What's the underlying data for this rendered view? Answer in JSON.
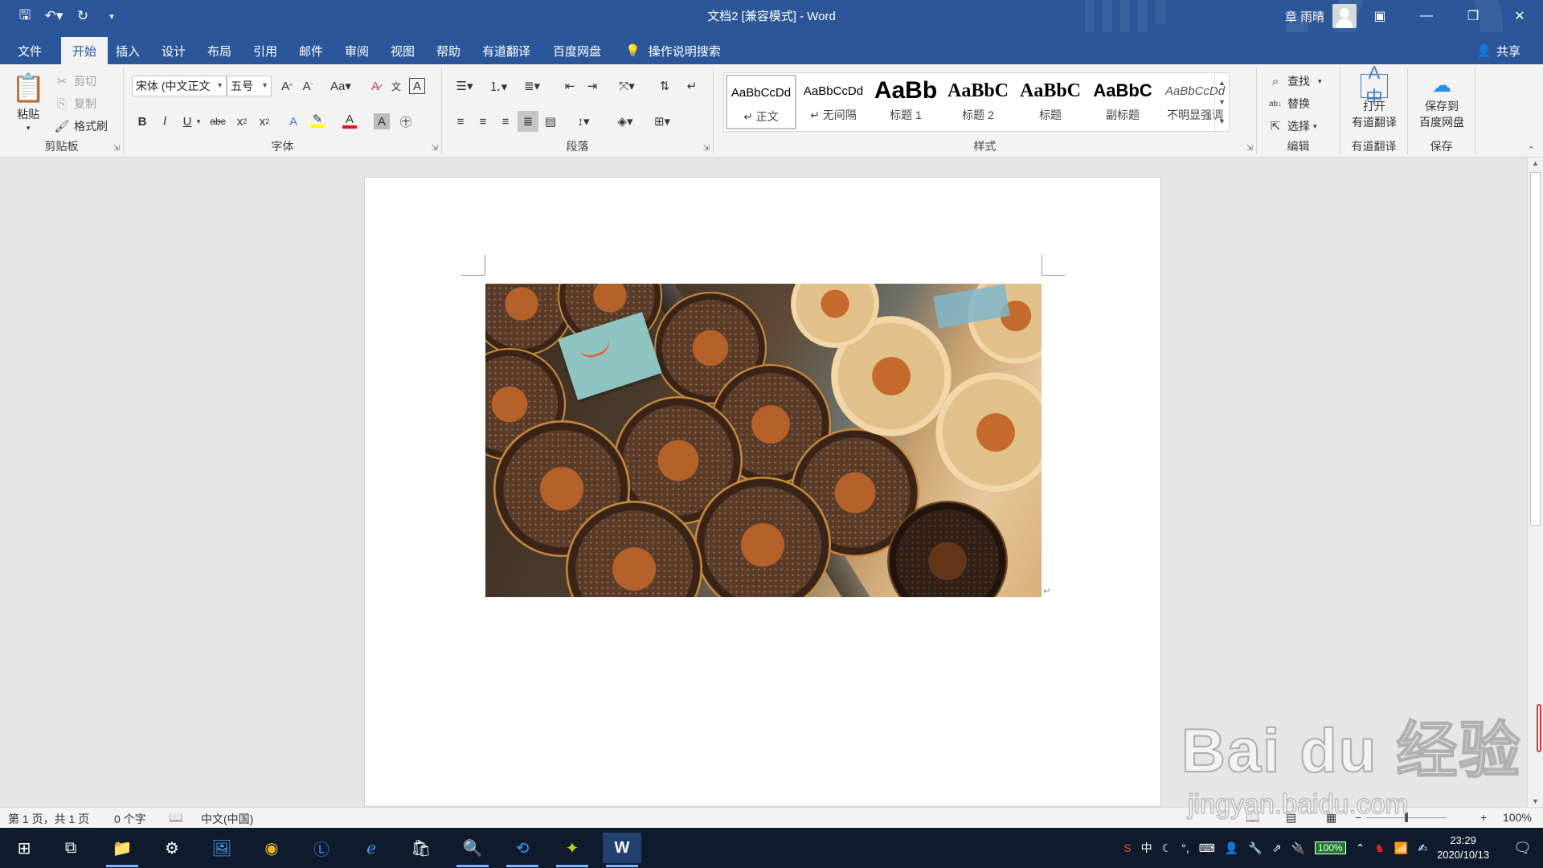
{
  "window": {
    "title": "文档2 [兼容模式]  -  Word",
    "user": "章 雨晴"
  },
  "quick_access": {
    "save_icon": "save-icon",
    "undo_icon": "undo-icon",
    "redo_icon": "redo-icon",
    "customize_icon": "customize-qat-icon"
  },
  "tabs": [
    "文件",
    "开始",
    "插入",
    "设计",
    "布局",
    "引用",
    "邮件",
    "审阅",
    "视图",
    "帮助",
    "有道翻译",
    "百度网盘"
  ],
  "active_tab": "开始",
  "tellme": "操作说明搜索",
  "share": "共享",
  "clipboard": {
    "paste": "粘贴",
    "cut": "剪切",
    "copy": "复制",
    "format_painter": "格式刷",
    "label": "剪贴板"
  },
  "font": {
    "name": "宋体 (中文正文",
    "size": "五号",
    "label": "字体",
    "highlight_color": "#ffff00",
    "font_color": "#e81123"
  },
  "paragraph": {
    "label": "段落"
  },
  "styles": {
    "label": "样式",
    "items": [
      {
        "sample": "AaBbCcDd",
        "name": "↵ 正文"
      },
      {
        "sample": "AaBbCcDd",
        "name": "↵ 无间隔"
      },
      {
        "sample": "AaBb",
        "name": "标题 1"
      },
      {
        "sample": "AaBbC",
        "name": "标题 2"
      },
      {
        "sample": "AaBbC",
        "name": "标题"
      },
      {
        "sample": "AaBbC",
        "name": "副标题"
      },
      {
        "sample": "AaBbCcDd",
        "name": "不明显强调"
      }
    ]
  },
  "editing": {
    "find": "查找",
    "replace": "替换",
    "select": "选择",
    "label": "编辑"
  },
  "youdao": {
    "open": "打开",
    "translate": "有道翻译",
    "label": "有道翻译"
  },
  "baidu": {
    "save_to": "保存到",
    "pan": "百度网盘",
    "label": "保存"
  },
  "status": {
    "page": "第 1 页，共 1 页",
    "words": "0 个字",
    "language": "中文(中国)",
    "zoom": "100%"
  },
  "taskbar": {
    "battery": "100%",
    "time": "23:29",
    "date": "2020/10/13",
    "ime": "中"
  },
  "watermark": {
    "main": "Bai du 经验",
    "sub": "jingyan.baidu.com"
  }
}
